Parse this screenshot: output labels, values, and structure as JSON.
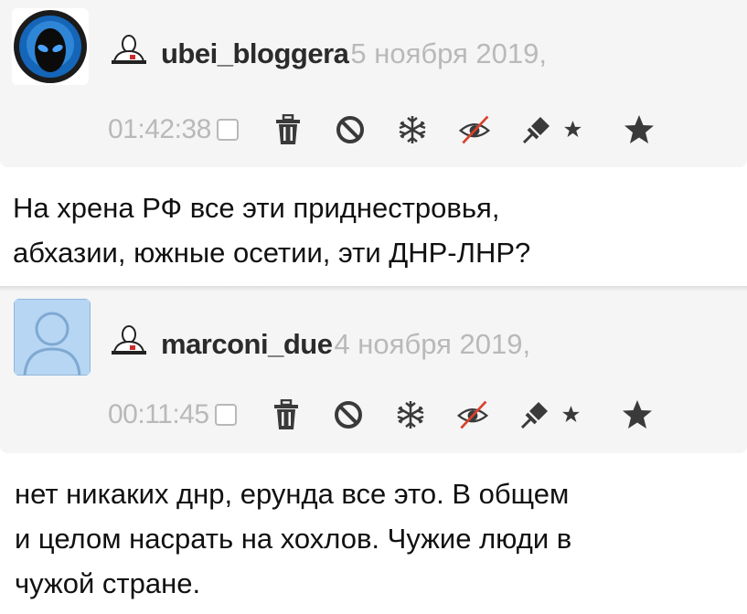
{
  "comments": [
    {
      "username": "ubei_bloggera",
      "date": "5 ноября 2019,",
      "time": "01:42:38",
      "text_lines": [
        "На хрена РФ все эти приднестровья,",
        "абхазии, южные осетии, эти ДНР-ЛНР?"
      ],
      "avatar_icon": "alien-avatar"
    },
    {
      "username": "marconi_due",
      "date": "4 ноября 2019,",
      "time": "00:11:45",
      "text_lines": [
        "нет никаких днр, ерунда все это. В общем",
        "и целом насрать на хохлов. Чужие люди в",
        "чужой стране."
      ],
      "avatar_icon": "default-user-avatar"
    }
  ],
  "icons": [
    "user-icon",
    "checkbox",
    "trash-icon",
    "ban-icon",
    "snowflake-icon",
    "hide-eye-icon",
    "pin-icon",
    "star-icon"
  ],
  "colors": {
    "header_bg": "#f5f5f5",
    "muted_text": "#b9b9b9",
    "icon_color": "#3a3a3a",
    "strike_red": "#d9412b"
  }
}
